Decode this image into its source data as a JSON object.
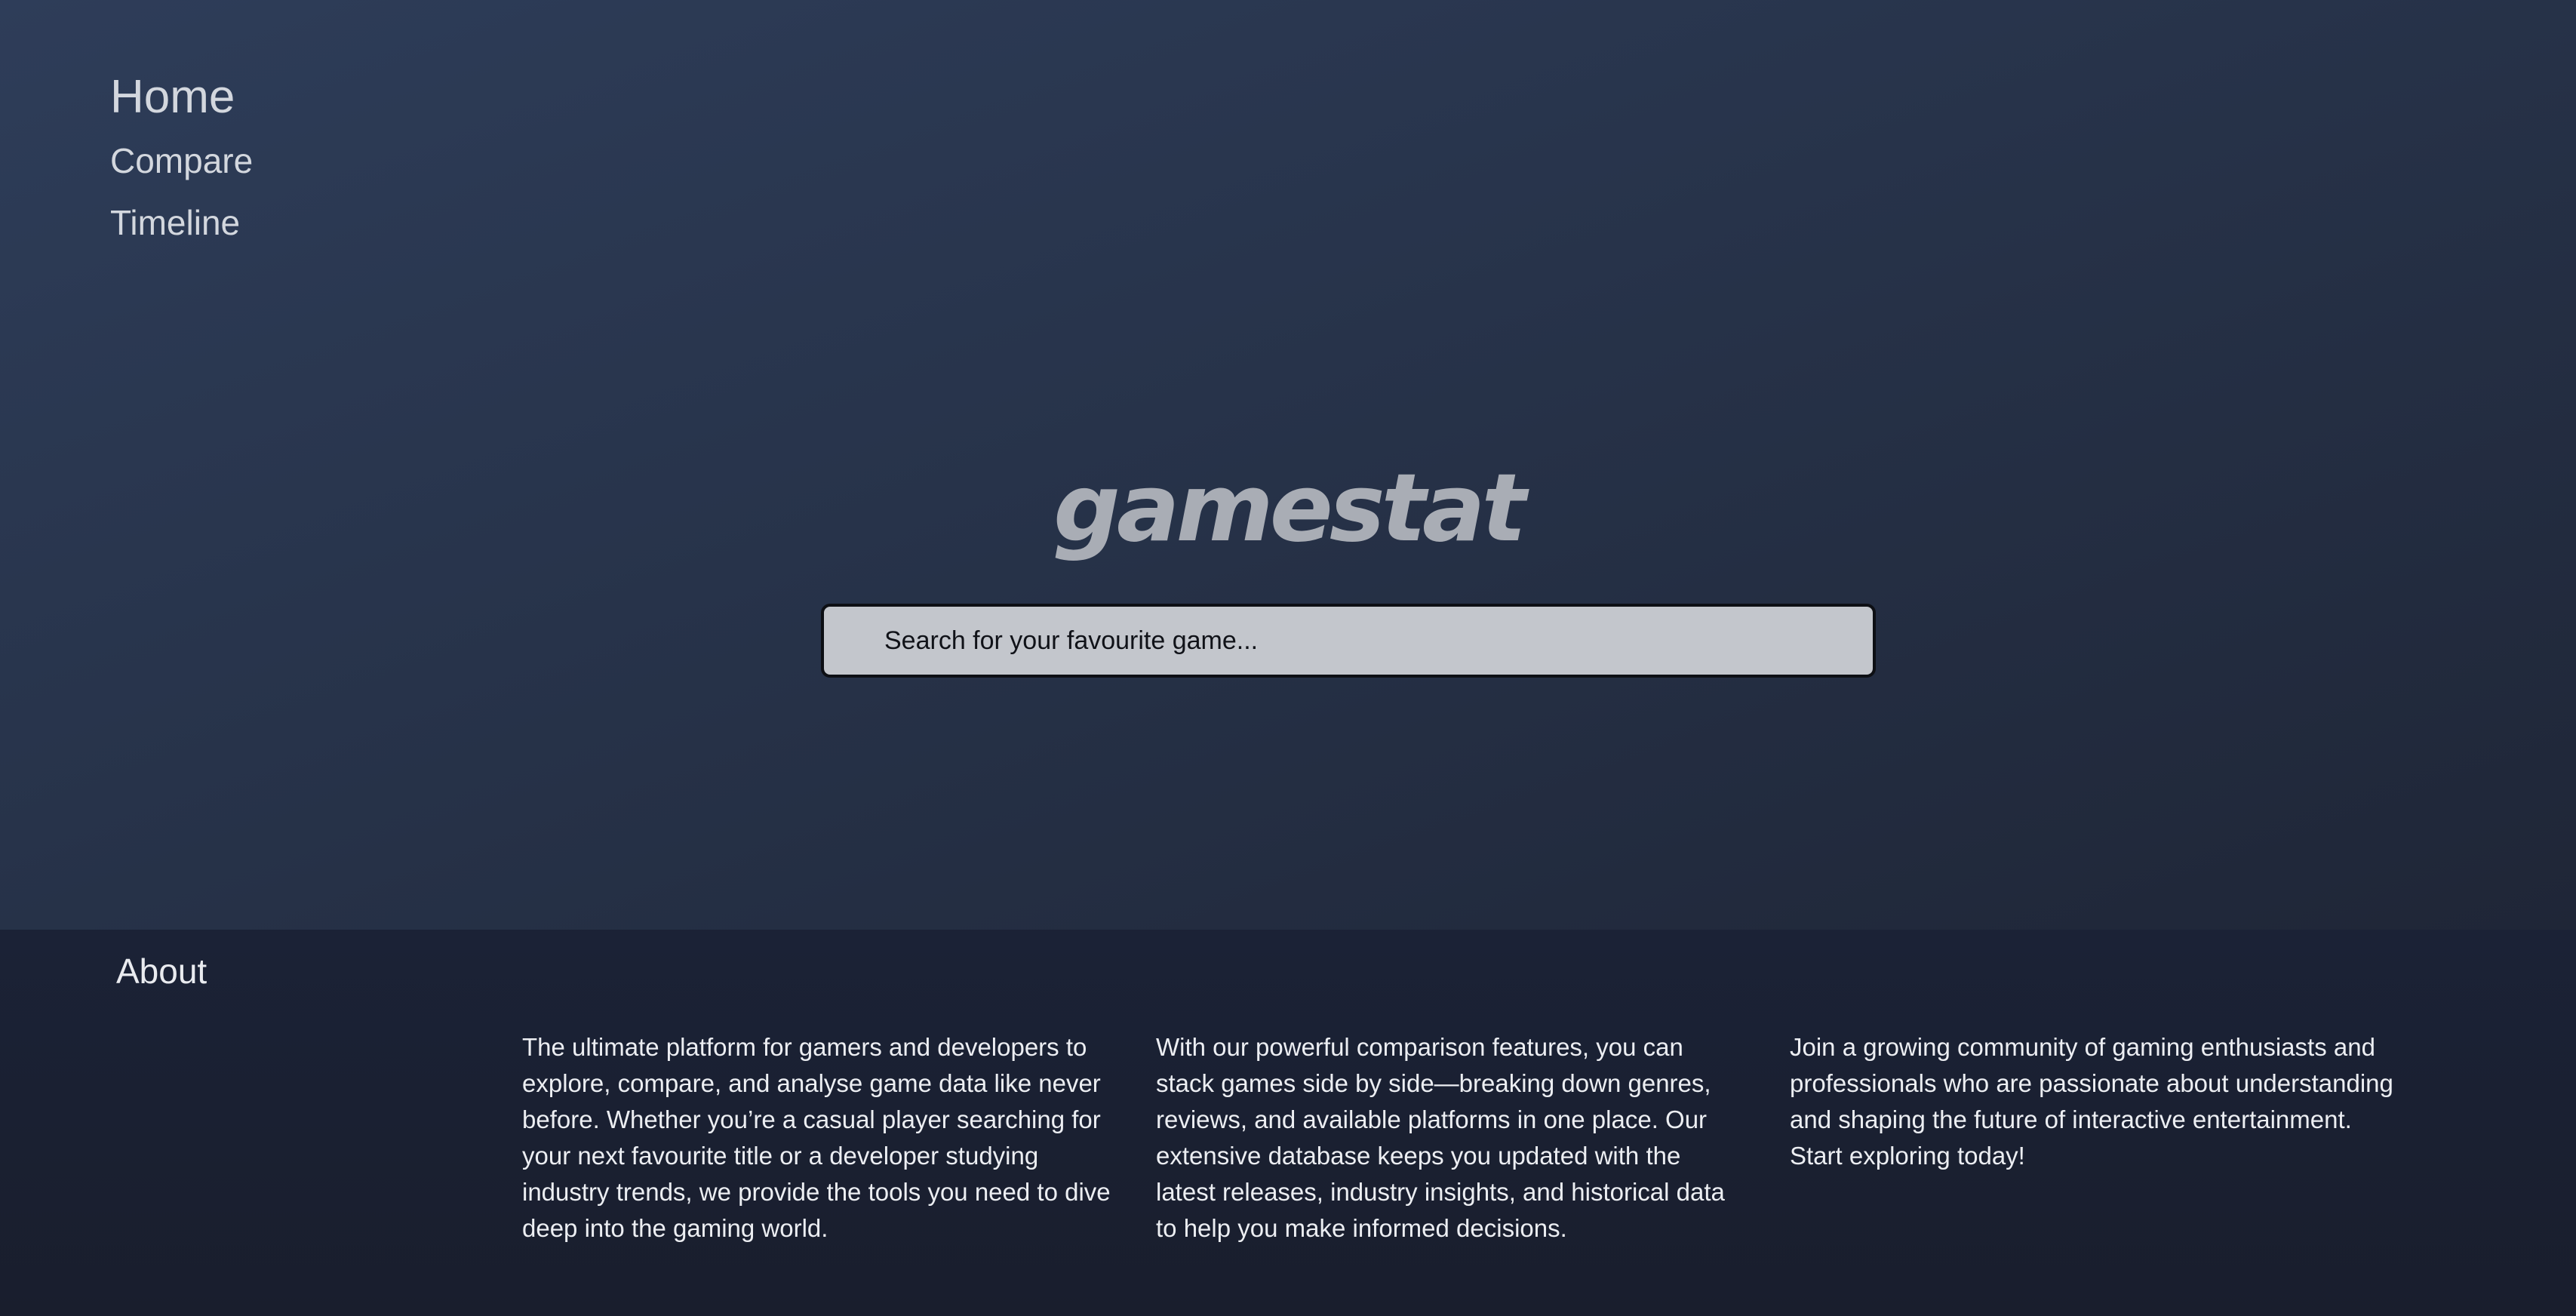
{
  "nav": {
    "home": "Home",
    "compare": "Compare",
    "timeline": "Timeline"
  },
  "logo": {
    "text": "gamestat"
  },
  "search": {
    "placeholder": "Search for your favourite game..."
  },
  "about": {
    "title": "About",
    "columns": [
      "The ultimate platform for gamers and developers to explore, compare, and analyse game data like never before. Whether you’re a casual player searching for your next favourite title or a developer studying industry trends, we provide the tools you need to dive deep into the gaming world.",
      "With our powerful comparison features, you can stack games side by side—breaking down genres, reviews, and available platforms in one place. Our extensive database keeps you updated with the latest releases, industry insights, and historical data to help you make informed decisions.",
      "Join a growing community of gaming enthusiasts and professionals who are passionate about understanding and shaping the future of interactive entertainment. Start exploring today!"
    ]
  },
  "colors": {
    "hero_bg": "#2a3650",
    "footer_bg": "#1a2031",
    "logo": "#a9adb5",
    "search_bg": "#c3c6cc",
    "text": "#e9ebef"
  }
}
